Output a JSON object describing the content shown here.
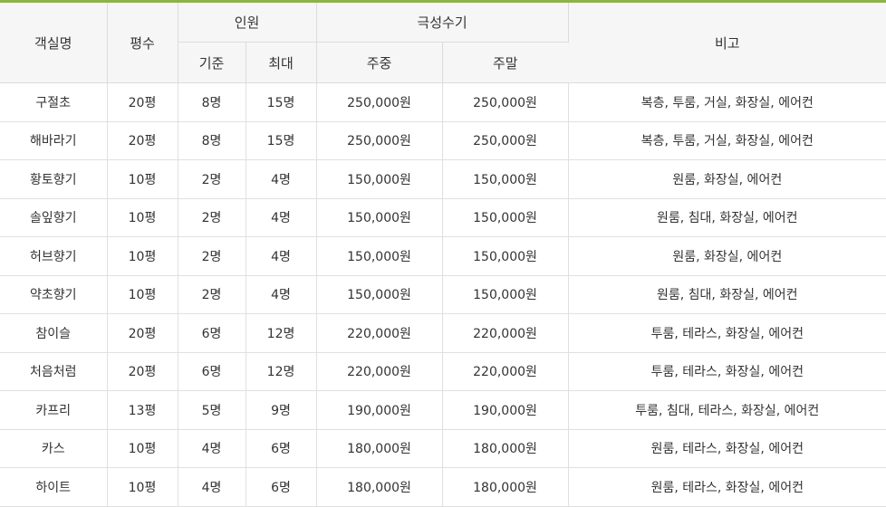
{
  "headers": {
    "room_name": "객실명",
    "size": "평수",
    "people": "인원",
    "people_standard": "기준",
    "people_max": "최대",
    "peak_season": "극성수기",
    "weekday": "주중",
    "weekend": "주말",
    "notes": "비고"
  },
  "rows": [
    {
      "name": "구절초",
      "size": "20평",
      "std": "8명",
      "max": "15명",
      "weekday": "250,000원",
      "weekend": "250,000원",
      "notes": "복층, 투룸, 거실, 화장실, 에어컨"
    },
    {
      "name": "해바라기",
      "size": "20평",
      "std": "8명",
      "max": "15명",
      "weekday": "250,000원",
      "weekend": "250,000원",
      "notes": "복층, 투룸, 거실, 화장실, 에어컨"
    },
    {
      "name": "황토향기",
      "size": "10평",
      "std": "2명",
      "max": "4명",
      "weekday": "150,000원",
      "weekend": "150,000원",
      "notes": "원룸, 화장실, 에어컨"
    },
    {
      "name": "솔잎향기",
      "size": "10평",
      "std": "2명",
      "max": "4명",
      "weekday": "150,000원",
      "weekend": "150,000원",
      "notes": "원룸, 침대, 화장실, 에어컨"
    },
    {
      "name": "허브향기",
      "size": "10평",
      "std": "2명",
      "max": "4명",
      "weekday": "150,000원",
      "weekend": "150,000원",
      "notes": "원룸, 화장실, 에어컨"
    },
    {
      "name": "약초향기",
      "size": "10평",
      "std": "2명",
      "max": "4명",
      "weekday": "150,000원",
      "weekend": "150,000원",
      "notes": "원룸, 침대, 화장실, 에어컨"
    },
    {
      "name": "참이슬",
      "size": "20평",
      "std": "6명",
      "max": "12명",
      "weekday": "220,000원",
      "weekend": "220,000원",
      "notes": "투룸, 테라스, 화장실, 에어컨"
    },
    {
      "name": "처음처럼",
      "size": "20평",
      "std": "6명",
      "max": "12명",
      "weekday": "220,000원",
      "weekend": "220,000원",
      "notes": "투룸, 테라스, 화장실, 에어컨"
    },
    {
      "name": "카프리",
      "size": "13평",
      "std": "5명",
      "max": "9명",
      "weekday": "190,000원",
      "weekend": "190,000원",
      "notes": "투룸, 침대, 테라스, 화장실, 에어컨"
    },
    {
      "name": "카스",
      "size": "10평",
      "std": "4명",
      "max": "6명",
      "weekday": "180,000원",
      "weekend": "180,000원",
      "notes": "원룸, 테라스, 화장실, 에어컨"
    },
    {
      "name": "하이트",
      "size": "10평",
      "std": "4명",
      "max": "6명",
      "weekday": "180,000원",
      "weekend": "180,000원",
      "notes": "원룸, 테라스, 화장실, 에어컨"
    }
  ],
  "colors": {
    "accent_border": "#8fb14b",
    "header_bg": "#f6f6f6",
    "grid_line": "#e0e0e0",
    "text": "#333333"
  }
}
